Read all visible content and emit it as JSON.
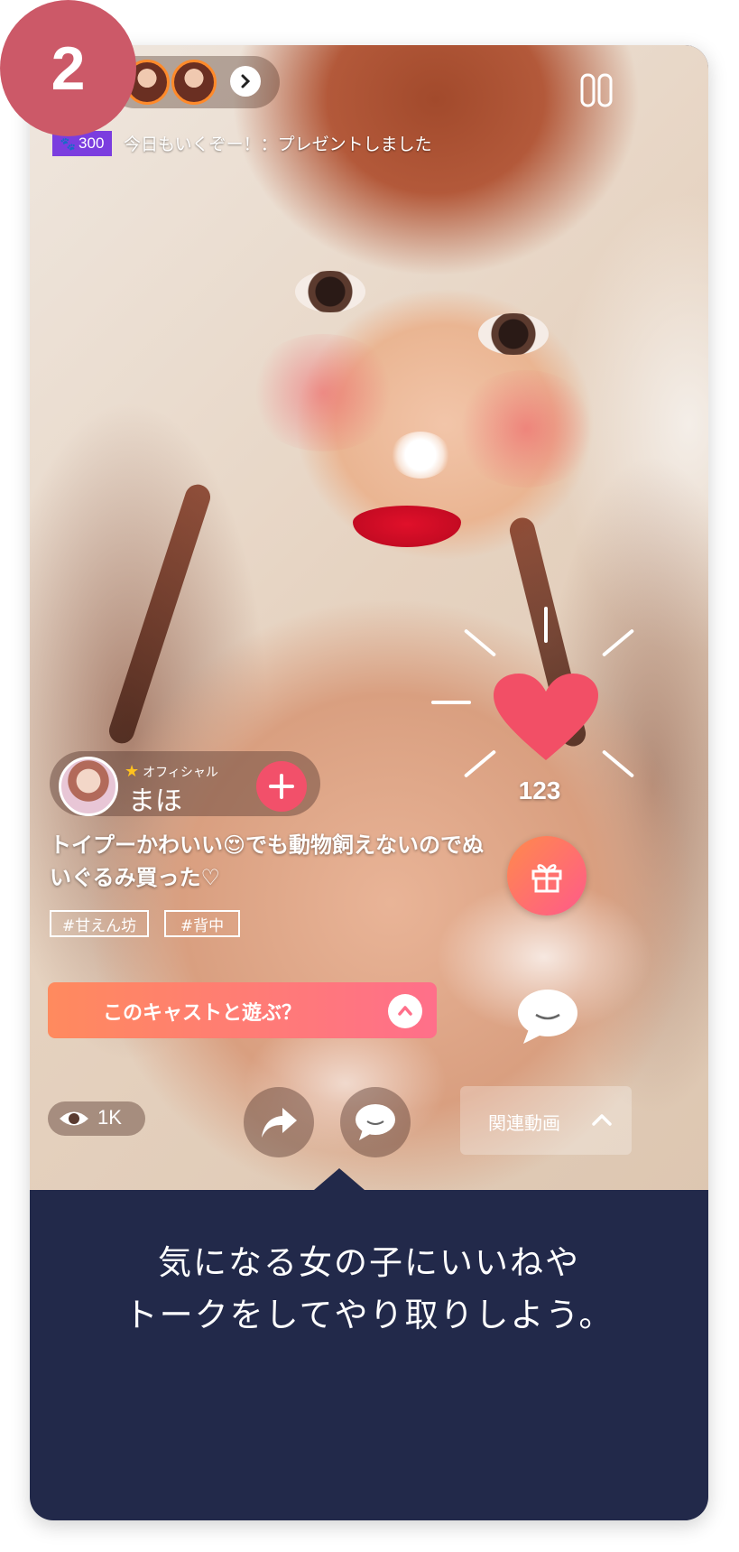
{
  "step_number": "2",
  "colors": {
    "step_badge": "#cc5968",
    "panel_bg": "#22294a",
    "like_heart": "#f24f66",
    "play_gradient": [
      "#ff8a5e",
      "#ff6f8a"
    ],
    "gift_gradient": [
      "#ff8a4c",
      "#ff5a8a"
    ],
    "paw_badge": "#7b3ddf"
  },
  "top_bar": {
    "viewer_avatars": [
      "avatar",
      "avatar"
    ],
    "expand_icon": "chevron-right-icon",
    "exit_icon": "exit-icon"
  },
  "gift_notice": {
    "points": "300",
    "message": "今日もいくぞー！：プレゼントしました"
  },
  "like": {
    "count": "123"
  },
  "cast": {
    "badge": "オフィシャル",
    "name": "まほ",
    "caption_line1": "トイプーかわいい😍でも動物飼えないのでぬ",
    "caption_line2": "いぐるみ買った♡",
    "tags": [
      "#甘えん坊",
      "#背中"
    ]
  },
  "play_cta": {
    "label": "このキャストと遊ぶ？"
  },
  "views": {
    "count": "1K"
  },
  "related": {
    "label": "関連動画"
  },
  "bottom_message": {
    "line1": "気になる女の子にいいねや",
    "line2": "トークをしてやり取りしよう。"
  }
}
